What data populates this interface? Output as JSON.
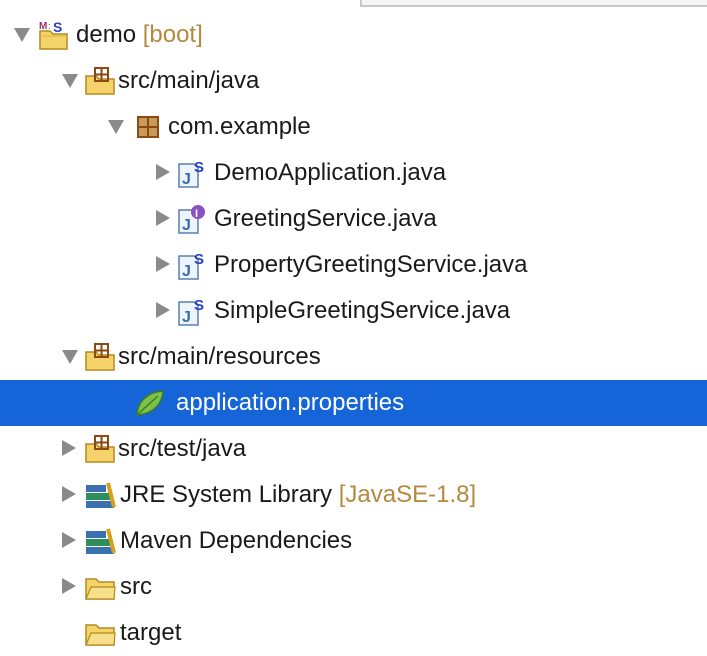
{
  "tree": {
    "project": {
      "label": "demo",
      "decoration": "[boot]"
    },
    "src_main_java": {
      "label": "src/main/java"
    },
    "package": {
      "label": "com.example"
    },
    "files": [
      {
        "label": "DemoApplication.java"
      },
      {
        "label": "GreetingService.java"
      },
      {
        "label": "PropertyGreetingService.java"
      },
      {
        "label": "SimpleGreetingService.java"
      }
    ],
    "src_main_resources": {
      "label": "src/main/resources"
    },
    "application_properties": {
      "label": "application.properties",
      "selected": true
    },
    "src_test_java": {
      "label": "src/test/java"
    },
    "jre_library": {
      "label": "JRE System Library",
      "decoration": "[JavaSE-1.8]"
    },
    "maven_dependencies": {
      "label": "Maven Dependencies"
    },
    "src_folder": {
      "label": "src"
    },
    "target_folder": {
      "label": "target"
    }
  },
  "colors": {
    "selection": "#1565d8",
    "decoration_text": "#b48a3c",
    "twisty": "#8a8a8a"
  },
  "icons": {
    "project": "spring-maven-project-icon",
    "source_folder": "source-folder-icon",
    "package": "package-icon",
    "class": "spring-java-class-icon",
    "interface": "java-interface-icon",
    "properties": "spring-properties-leaf-icon",
    "library": "library-icon",
    "folder": "folder-icon"
  }
}
